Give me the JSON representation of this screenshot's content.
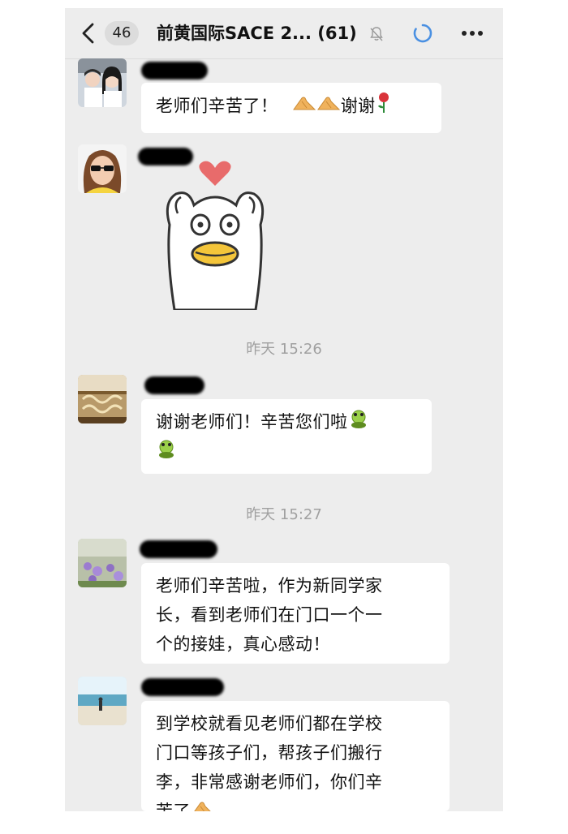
{
  "header": {
    "unread_count": "46",
    "title": "前黄国际SACE 2... (61)",
    "icons": [
      "back-icon",
      "mute-icon",
      "loading-icon",
      "more-icon"
    ]
  },
  "messages": [
    {
      "type": "text",
      "text": "老师们辛苦了！",
      "trailing_text": "谢谢",
      "emoji": [
        "clap-hands-emoji",
        "clap-hands-emoji",
        "rose-emoji"
      ]
    },
    {
      "type": "sticker",
      "sticker": "duck-heart-sticker"
    },
    {
      "type": "timestamp",
      "text": "昨天 15:26"
    },
    {
      "type": "text",
      "line1": "谢谢老师们！辛苦您们啦",
      "emoji": [
        "frog-emoji",
        "frog-emoji"
      ]
    },
    {
      "type": "timestamp",
      "text": "昨天 15:27"
    },
    {
      "type": "text",
      "lines": [
        "老师们辛苦啦，作为新同学家",
        "长，看到老师们在门口一个一",
        "个的接娃，真心感动！"
      ]
    },
    {
      "type": "text",
      "lines": [
        "到学校就看见老师们都在学校",
        "门口等孩子们，帮孩子们搬行",
        "李，非常感谢老师们，你们辛",
        "苦了"
      ],
      "emoji": [
        "clap-hands-emoji"
      ]
    }
  ],
  "colors": {
    "chat_bg": "#ededed",
    "bubble_bg": "#ffffff",
    "loading_accent": "#4a90e2"
  }
}
